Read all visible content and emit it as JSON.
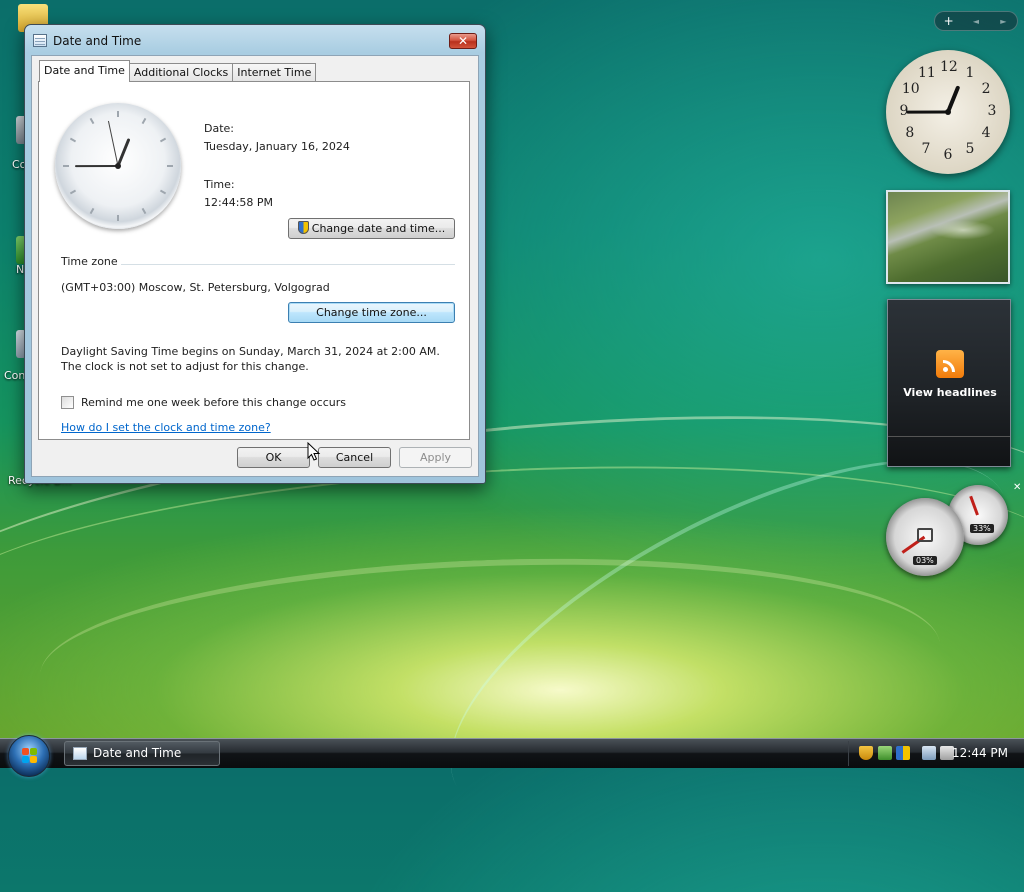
{
  "desktop": {
    "icon_labels": [
      "Co",
      "N",
      "Con",
      "Recycle B..."
    ]
  },
  "dialog": {
    "title": "Date and Time",
    "close_glyph": "✕",
    "tabs": [
      {
        "label": "Date and Time",
        "active": true
      },
      {
        "label": "Additional Clocks",
        "active": false
      },
      {
        "label": "Internet Time",
        "active": false
      }
    ],
    "date_label": "Date:",
    "date_value": "Tuesday, January 16, 2024",
    "time_label": "Time:",
    "time_value": "12:44:58 PM",
    "change_datetime_button": "Change date and time...",
    "timezone_heading": "Time zone",
    "timezone_value": "(GMT+03:00) Moscow, St. Petersburg, Volgograd",
    "change_timezone_button": "Change time zone...",
    "dst_notice": "Daylight Saving Time begins on Sunday, March 31, 2024 at 2:00 AM. The clock is not set to adjust for this change.",
    "remind_checkbox_label": "Remind me one week before this change occurs",
    "remind_checked": false,
    "help_link": "How do I set the clock and time zone?",
    "ok_button": "OK",
    "cancel_button": "Cancel",
    "apply_button": "Apply",
    "analog_clock": {
      "hours": 12,
      "minutes": 44,
      "seconds": 58
    }
  },
  "sidebar": {
    "toolbar": {
      "add_glyph": "+",
      "prev_glyph": "◄",
      "next_glyph": "►"
    },
    "clock_numbers": [
      "12",
      "1",
      "2",
      "3",
      "4",
      "5",
      "6",
      "7",
      "8",
      "9",
      "10",
      "11"
    ],
    "feed_text": "View headlines",
    "cpu_gauge_label": "03%",
    "memory_gauge_label": "33%",
    "gauge_close_glyph": "✕"
  },
  "taskbar": {
    "window_button": "Date and Time",
    "clock": "12:44 PM"
  },
  "colors": {
    "accent": "#3c7fb1",
    "link": "#0066cc",
    "close_red": "#c7432b"
  }
}
